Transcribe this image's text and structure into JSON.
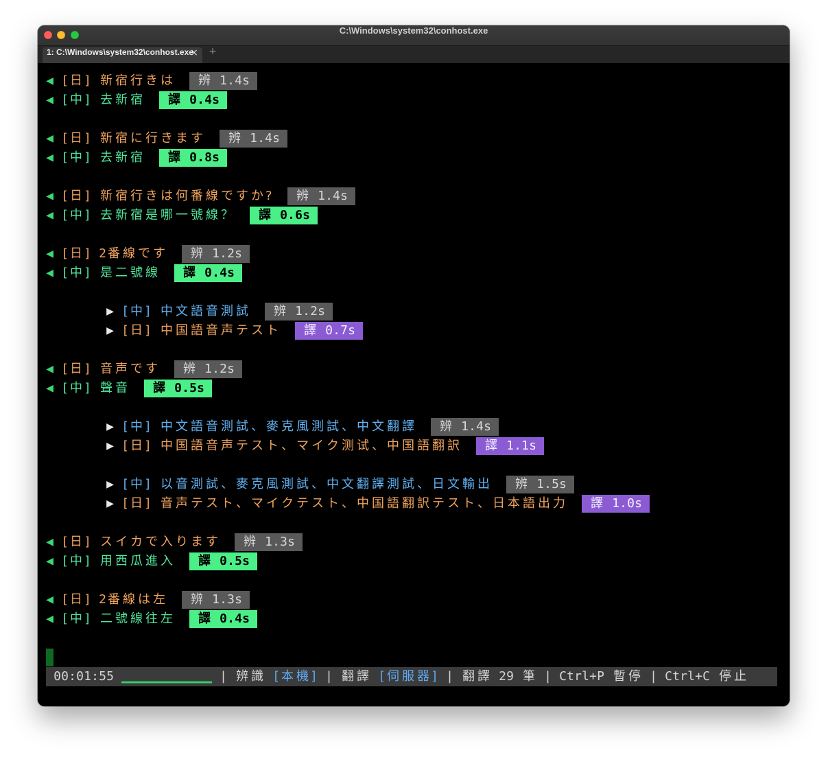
{
  "window": {
    "title": "C:\\Windows\\system32\\conhost.exe"
  },
  "tabs": [
    {
      "label": "1: C:\\Windows\\system32\\conhost.exe",
      "close": "×"
    }
  ],
  "new_tab": "+",
  "transcript": [
    {
      "arrow": "◀",
      "tag": "[日]",
      "text": "新宿行きは",
      "badge": {
        "label": "辨",
        "time": "1.4s"
      }
    },
    {
      "arrow": "◀",
      "tag": "[中]",
      "text": "去新宿",
      "badge": {
        "label": "譯",
        "time": "0.4s"
      }
    },
    {
      "arrow": "◀",
      "tag": "[日]",
      "text": "新宿に行きます",
      "badge": {
        "label": "辨",
        "time": "1.4s"
      }
    },
    {
      "arrow": "◀",
      "tag": "[中]",
      "text": "去新宿",
      "badge": {
        "label": "譯",
        "time": "0.8s"
      }
    },
    {
      "arrow": "◀",
      "tag": "[日]",
      "text": "新宿行きは何番線ですか?",
      "badge": {
        "label": "辨",
        "time": "1.4s"
      }
    },
    {
      "arrow": "◀",
      "tag": "[中]",
      "text": "去新宿是哪一號線？",
      "badge": {
        "label": "譯",
        "time": "0.6s"
      }
    },
    {
      "arrow": "◀",
      "tag": "[日]",
      "text": "2番線です",
      "badge": {
        "label": "辨",
        "time": "1.2s"
      }
    },
    {
      "arrow": "◀",
      "tag": "[中]",
      "text": "是二號線",
      "badge": {
        "label": "譯",
        "time": "0.4s"
      }
    },
    {
      "arrow": "▶",
      "tag": "[中]",
      "text": "中文語音測試",
      "badge": {
        "label": "辨",
        "time": "1.2s"
      }
    },
    {
      "arrow": "▶",
      "tag": "[日]",
      "text": "中国語音声テスト",
      "badge": {
        "label": "譯",
        "time": "0.7s"
      }
    },
    {
      "arrow": "◀",
      "tag": "[日]",
      "text": "音声です",
      "badge": {
        "label": "辨",
        "time": "1.2s"
      }
    },
    {
      "arrow": "◀",
      "tag": "[中]",
      "text": "聲音",
      "badge": {
        "label": "譯",
        "time": "0.5s"
      }
    },
    {
      "arrow": "▶",
      "tag": "[中]",
      "text": "中文語音測試、麥克風測試、中文翻譯",
      "badge": {
        "label": "辨",
        "time": "1.4s"
      }
    },
    {
      "arrow": "▶",
      "tag": "[日]",
      "text": "中国語音声テスト、マイク测试、中国語翻訳",
      "badge": {
        "label": "譯",
        "time": "1.1s"
      }
    },
    {
      "arrow": "▶",
      "tag": "[中]",
      "text": "以音測試、麥克風測試、中文翻譯測試、日文輸出",
      "badge": {
        "label": "辨",
        "time": "1.5s"
      }
    },
    {
      "arrow": "▶",
      "tag": "[日]",
      "text": "音声テスト、マイクテスト、中国語翻訳テスト、日本語出力",
      "badge": {
        "label": "譯",
        "time": "1.0s"
      }
    },
    {
      "arrow": "◀",
      "tag": "[日]",
      "text": "スイカで入ります",
      "badge": {
        "label": "辨",
        "time": "1.3s"
      }
    },
    {
      "arrow": "◀",
      "tag": "[中]",
      "text": "用西瓜進入",
      "badge": {
        "label": "譯",
        "time": "0.5s"
      }
    },
    {
      "arrow": "◀",
      "tag": "[日]",
      "text": "2番線は左",
      "badge": {
        "label": "辨",
        "time": "1.3s"
      }
    },
    {
      "arrow": "◀",
      "tag": "[中]",
      "text": "二號線往左",
      "badge": {
        "label": "譯",
        "time": "0.4s"
      }
    }
  ],
  "status_bar": {
    "elapsed": "00:01:55",
    "level_meter": "▁▁▁▁▁▁▁▁▁▁▁▁",
    "separator": "|",
    "recognition_label": "辨識",
    "recognition_mode": "[本機]",
    "translation_label": "翻譯",
    "translation_mode": "[伺服器]",
    "translation_count": "翻譯 29 筆",
    "pause_hint": "Ctrl+P 暫停",
    "stop_hint": "Ctrl+C 停止"
  },
  "colors": {
    "terminal_bg": "#000000",
    "ja_text": "#f0a35e",
    "zh_text": "#50e59c",
    "zh_text_indented": "#63b3f4",
    "arrow_left": "#3cd873",
    "arrow_right": "#e8e8e8",
    "recognition_badge_bg": "#595959",
    "recognition_badge_text": "#d8d8d8",
    "translation_badge_bg": "#4bef87",
    "translation_badge_text": "#000000",
    "translation_badge_indented_bg": "#8a5bd3",
    "translation_badge_indented_text": "#f4efff",
    "status_bar_bg": "#3b3b3b",
    "status_bar_text": "#d4d4d4",
    "status_mode_text": "#5ea9f2",
    "level_meter": "#37d06a",
    "cursor": "#0d6a23",
    "close_button": "#ff5f57",
    "minimize_button": "#febc2e",
    "maximize_button": "#28c840"
  }
}
